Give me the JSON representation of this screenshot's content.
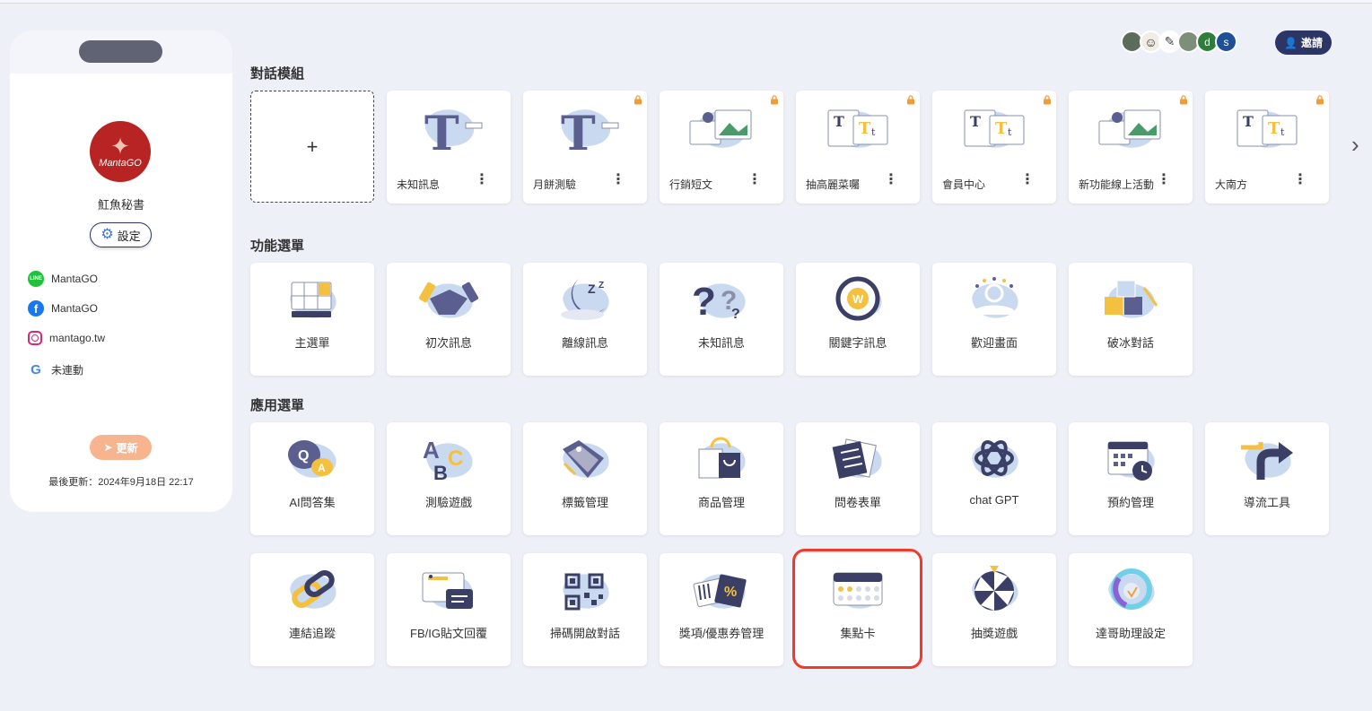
{
  "profile": {
    "name": "魟魚秘書",
    "settings_label": "設定",
    "social": [
      {
        "type": "line",
        "label": "MantaGO"
      },
      {
        "type": "facebook",
        "label": "MantaGO"
      },
      {
        "type": "instagram",
        "label": "mantago.tw"
      },
      {
        "type": "google",
        "label": "未連動"
      }
    ],
    "update_label": "更新",
    "last_update": "最後更新：2024年9月18日 22:17",
    "avatar_text": "MantaGO"
  },
  "header": {
    "invite_label": "邀請",
    "collaborators": [
      "d",
      "s"
    ]
  },
  "sections": {
    "dialog_modules": "對話模組",
    "function_menu": "功能選單",
    "app_menu": "應用選單"
  },
  "templates": [
    {
      "label": "未知訊息",
      "locked": false,
      "icon": "big-t-icon"
    },
    {
      "label": "月餅測驗",
      "locked": true,
      "icon": "big-t-icon"
    },
    {
      "label": "行銷短文",
      "locked": true,
      "icon": "image-cards-icon"
    },
    {
      "label": "抽高麗菜囑",
      "locked": true,
      "icon": "text-cards-icon"
    },
    {
      "label": "會員中心",
      "locked": true,
      "icon": "text-cards-icon"
    },
    {
      "label": "新功能線上活動",
      "locked": true,
      "icon": "image-cards-icon"
    },
    {
      "label": "大南方",
      "locked": true,
      "icon": "text-cards-icon"
    }
  ],
  "add_label": "+",
  "function_items": [
    {
      "label": "主選單",
      "icon": "menu-grid-icon"
    },
    {
      "label": "初次訊息",
      "icon": "handshake-icon"
    },
    {
      "label": "離線訊息",
      "icon": "sleep-moon-icon"
    },
    {
      "label": "未知訊息",
      "icon": "question-icon"
    },
    {
      "label": "關鍵字訊息",
      "icon": "keyword-icon"
    },
    {
      "label": "歡迎畫面",
      "icon": "welcome-icon"
    },
    {
      "label": "破冰對話",
      "icon": "ice-cubes-icon"
    }
  ],
  "app_items_row1": [
    {
      "label": "AI問答集",
      "icon": "qa-icon"
    },
    {
      "label": "測驗遊戲",
      "icon": "abc-icon"
    },
    {
      "label": "標籤管理",
      "icon": "tag-icon"
    },
    {
      "label": "商品管理",
      "icon": "shopping-bag-icon"
    },
    {
      "label": "問卷表單",
      "icon": "survey-icon"
    },
    {
      "label": "chat GPT",
      "icon": "chatgpt-icon"
    },
    {
      "label": "預約管理",
      "icon": "calendar-clock-icon"
    },
    {
      "label": "導流工具",
      "icon": "redirect-arrow-icon"
    }
  ],
  "app_items_row2": [
    {
      "label": "連結追蹤",
      "icon": "link-icon"
    },
    {
      "label": "FB/IG貼文回覆",
      "icon": "post-reply-icon"
    },
    {
      "label": "掃碼開啟對話",
      "icon": "qr-code-icon"
    },
    {
      "label": "獎項/優惠券管理",
      "icon": "coupon-icon"
    },
    {
      "label": "集點卡",
      "icon": "stamp-card-icon"
    },
    {
      "label": "抽獎遊戲",
      "icon": "prize-wheel-icon"
    },
    {
      "label": "達哥助理設定",
      "icon": "assistant-icon"
    }
  ],
  "colors": {
    "background": "#eef0f8",
    "navy": "#2c3566",
    "blob": "#c9d9ef",
    "accent_yellow": "#f3c13f",
    "highlight": "#ef3b2c",
    "update_orange": "#f6b58f"
  }
}
